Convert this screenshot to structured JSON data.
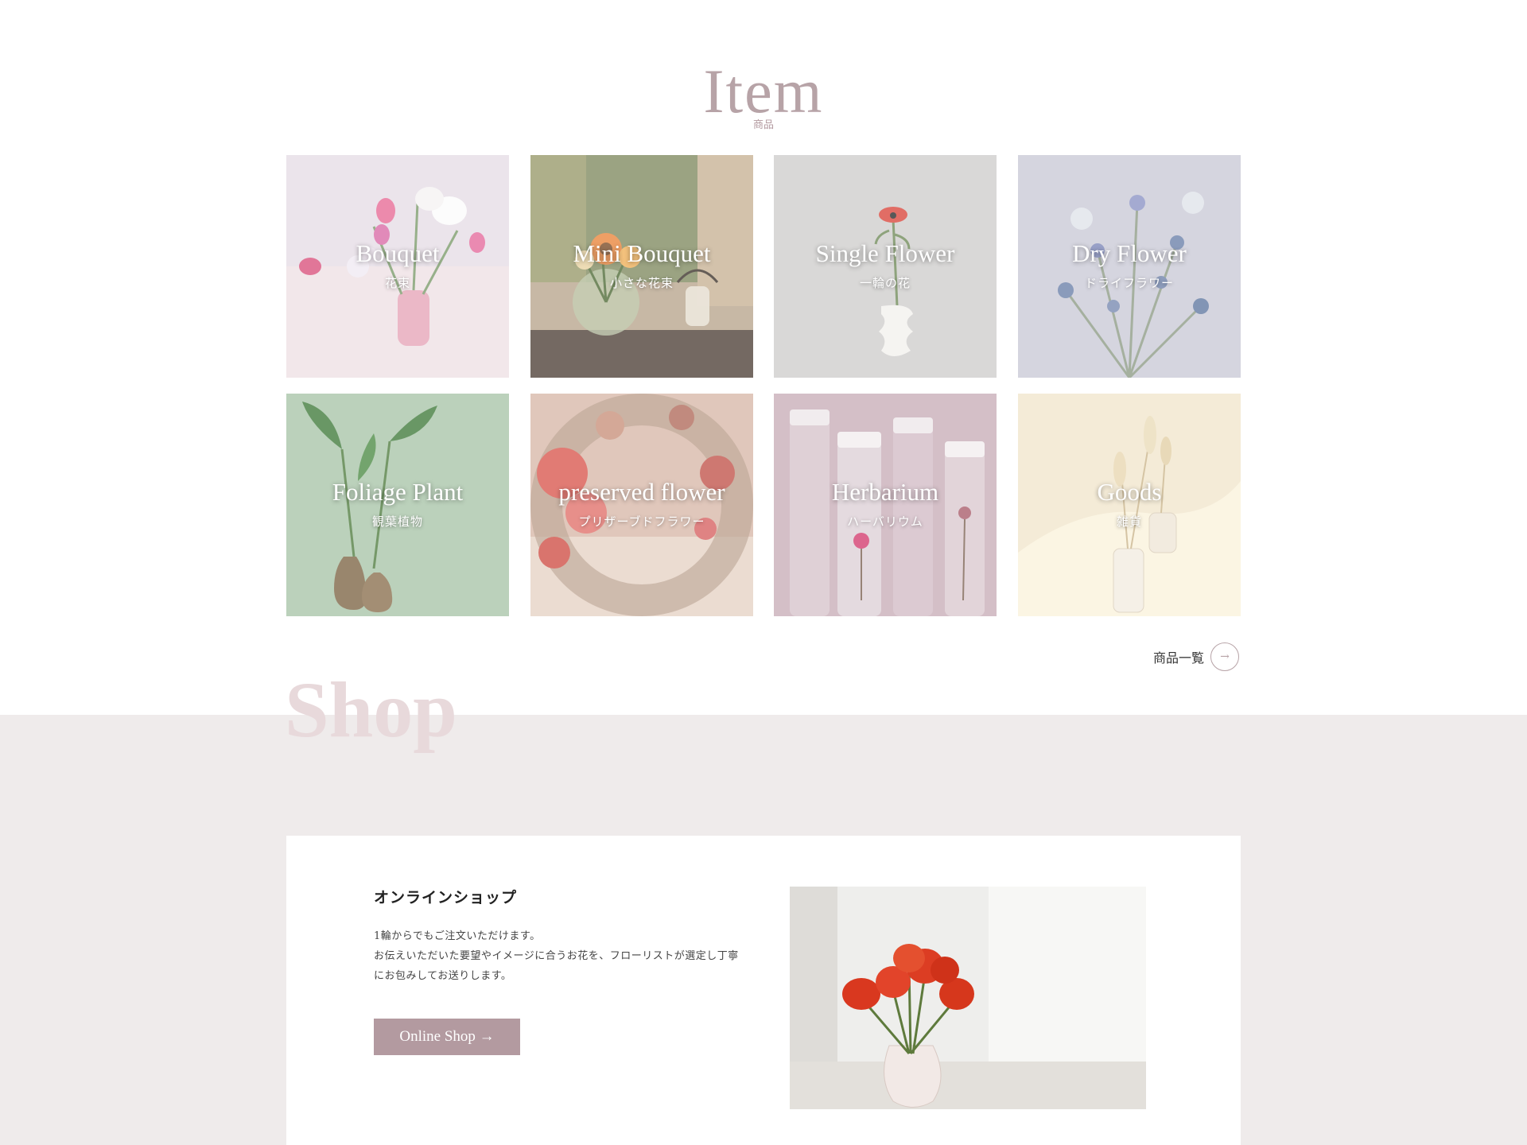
{
  "item_section": {
    "title": "Item",
    "subtitle": "商品",
    "tiles": [
      {
        "en": "Bouquet",
        "ja": "花束",
        "icon": "bouquet-photo"
      },
      {
        "en": "Mini Bouquet",
        "ja": "小さな花束",
        "icon": "mini-bouquet-photo"
      },
      {
        "en": "Single Flower",
        "ja": "一輪の花",
        "icon": "single-flower-photo"
      },
      {
        "en": "Dry Flower",
        "ja": "ドライフラワー",
        "icon": "dry-flower-photo"
      },
      {
        "en": "Foliage Plant",
        "ja": "観葉植物",
        "icon": "foliage-plant-photo"
      },
      {
        "en": "preserved flower",
        "ja": "プリザーブドフラワー",
        "icon": "preserved-flower-photo"
      },
      {
        "en": "Herbarium",
        "ja": "ハーバリウム",
        "icon": "herbarium-photo"
      },
      {
        "en": "Goods",
        "ja": "雑貨",
        "icon": "goods-photo"
      }
    ],
    "more_label": "商品一覧",
    "more_icon": "arrow-right-icon"
  },
  "shop_section": {
    "title": "Shop",
    "card": {
      "heading": "オンラインショップ",
      "body_line1": "1輪からでもご注文いただけます。",
      "body_line2": "お伝えいただいた要望やイメージに合うお花を、フローリストが選定し丁寧にお包みしてお送りします。",
      "button_label": "Online Shop →"
    }
  },
  "colors": {
    "accent": "#b39aa0",
    "title": "#b7a3a7",
    "shop_watermark": "#e8d9db",
    "band": "#efebeb"
  }
}
